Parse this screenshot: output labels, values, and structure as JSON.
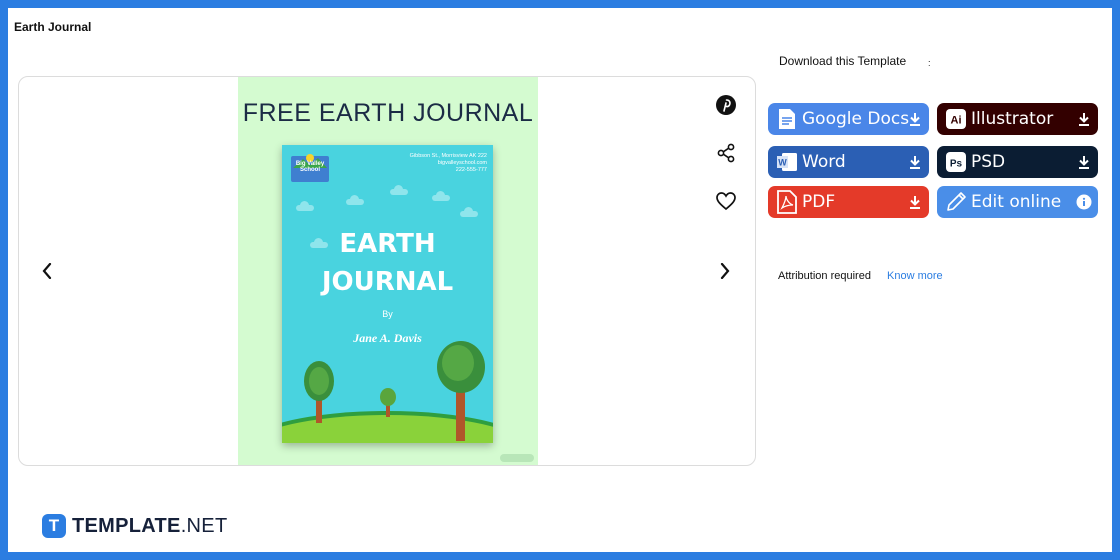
{
  "page": {
    "title": "Earth Journal"
  },
  "preview": {
    "heading": "FREE EARTH JOURNAL",
    "cover": {
      "logo_text": "Big Valley School",
      "address_line1": "Gibbson St., Morrisview AK 222",
      "address_line2": "bigvalleyschool.com",
      "address_line3": "222-555-777",
      "title_line1": "EARTH",
      "title_line2": "JOURNAL",
      "by": "By",
      "author": "Jane A. Davis"
    }
  },
  "download": {
    "label": "Download this Template",
    "colon": ":",
    "buttons": [
      {
        "label": "Google Docs",
        "color": "#4a86e8",
        "icon": "google-docs-icon"
      },
      {
        "label": "Illustrator",
        "color": "#330000",
        "icon": "illustrator-icon"
      },
      {
        "label": "Word",
        "color": "#2b5fb4",
        "icon": "word-icon"
      },
      {
        "label": "PSD",
        "color": "#0b1d33",
        "icon": "photoshop-icon"
      },
      {
        "label": "PDF",
        "color": "#e43a29",
        "icon": "pdf-icon"
      },
      {
        "label": "Edit online",
        "color": "#4a8ee8",
        "icon": "edit-pen-icon"
      }
    ]
  },
  "attribution": {
    "text": "Attribution required",
    "link": "Know more"
  },
  "brand": {
    "mark": "T",
    "name_bold": "TEMPLATE",
    "name_rest": ".NET"
  }
}
